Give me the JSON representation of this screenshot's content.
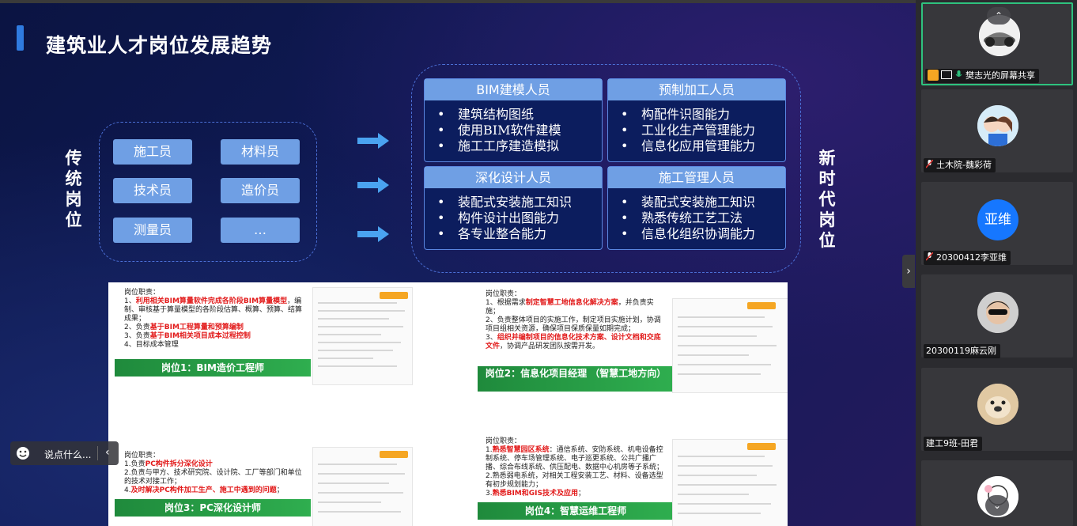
{
  "slide": {
    "title": "建筑业人才岗位发展趋势",
    "traditional_label": [
      "传",
      "统",
      "岗",
      "位"
    ],
    "new_label": [
      "新",
      "时",
      "代",
      "岗",
      "位"
    ],
    "traditional_roles": [
      "施工员",
      "材料员",
      "技术员",
      "造价员",
      "测量员",
      "…"
    ],
    "new_roles": [
      {
        "title": "BIM建模人员",
        "items": [
          "建筑结构图纸",
          "使用BIM软件建模",
          "施工工序建造模拟"
        ]
      },
      {
        "title": "预制加工人员",
        "items": [
          "构配件识图能力",
          "工业化生产管理能力",
          "信息化应用管理能力"
        ]
      },
      {
        "title": "深化设计人员",
        "items": [
          "装配式安装施工知识",
          "构件设计出图能力",
          "各专业整合能力"
        ]
      },
      {
        "title": "施工管理人员",
        "items": [
          "装配式安装施工知识",
          "熟悉传统工艺工法",
          "信息化组织协调能力"
        ]
      }
    ],
    "jobs": [
      {
        "banner": "岗位1：BIM造价工程师",
        "duties_title": "岗位职责：",
        "lines": [
          {
            "prefix": "1、",
            "red": "利用相关BIM算量软件完成各阶段BIM算量模型",
            "rest": "，编制、审核基于算量模型的各阶段估算、概算、预算、结算成果；"
          },
          {
            "prefix": "2、负责",
            "red": "基于BIM工程算量和预算编制",
            "rest": ""
          },
          {
            "prefix": "3、负责",
            "red": "基于BIM相关项目成本过程控制",
            "rest": ""
          },
          {
            "prefix": "4、",
            "red": "",
            "rest": "目标成本管理"
          }
        ]
      },
      {
        "banner": "岗位2：信息化项目经理 （智慧工地方向）",
        "duties_title": "岗位职责：",
        "lines": [
          {
            "prefix": "1、根据需求",
            "red": "制定智慧工地信息化解决方案",
            "rest": "，并负责实施；"
          },
          {
            "prefix": "2、",
            "red": "",
            "rest": "负责整体项目的实施工作，制定项目实施计划，协调项目组相关资源，确保项目保质保量如期完成；"
          },
          {
            "prefix": "3、",
            "red": "组织并编制项目的信息化技术方案、设计文档和交底文件",
            "rest": "，协调产品研发团队按需开发。"
          }
        ]
      },
      {
        "banner": "岗位3：PC深化设计师",
        "duties_title": "岗位职责：",
        "lines": [
          {
            "prefix": "1.负责",
            "red": "PC构件拆分深化设计",
            "rest": ""
          },
          {
            "prefix": "2.",
            "red": "",
            "rest": "负责与甲方、技术研究院、设计院、工厂等部门和单位的技术对接工作；"
          },
          {
            "prefix": "4.",
            "red": "及时解决PC构件加工生产、施工中遇到的问题",
            "rest": "；"
          }
        ]
      },
      {
        "banner": "岗位4：智慧运维工程师",
        "duties_title": "岗位职责：",
        "lines": [
          {
            "prefix": "1.",
            "red": "熟悉智慧园区系统",
            "rest": "：通信系统、安防系统、机电设备控制系统、停车场管理系统、电子巡更系统、公共广播广播、综合布线系统、供压配电、数据中心机房等子系统；"
          },
          {
            "prefix": "2.",
            "red": "",
            "rest": "熟悉弱电系统，对相关工程安装工艺、材料、设备选型有初步规划能力；"
          },
          {
            "prefix": "3.",
            "red": "熟悉BIM和GIS技术及应用",
            "rest": "；"
          }
        ]
      }
    ]
  },
  "chat": {
    "placeholder": "说点什么..."
  },
  "participants": [
    {
      "name": "樊志光的屏幕共享",
      "sharing": true
    },
    {
      "name": "土木院-魏彩荷",
      "muted": true
    },
    {
      "name": "20300412李亚维",
      "muted": true,
      "initials": "亚维"
    },
    {
      "name": "20300119麻云刚",
      "muted": false
    },
    {
      "name": "建工9班-田君",
      "muted": false
    },
    {
      "name": "",
      "muted": false
    }
  ],
  "colors": {
    "accent": "#6f9fe4",
    "green": "#2fae4f",
    "active_border": "#2ec27e",
    "avatar_blue": "#1677ff"
  }
}
